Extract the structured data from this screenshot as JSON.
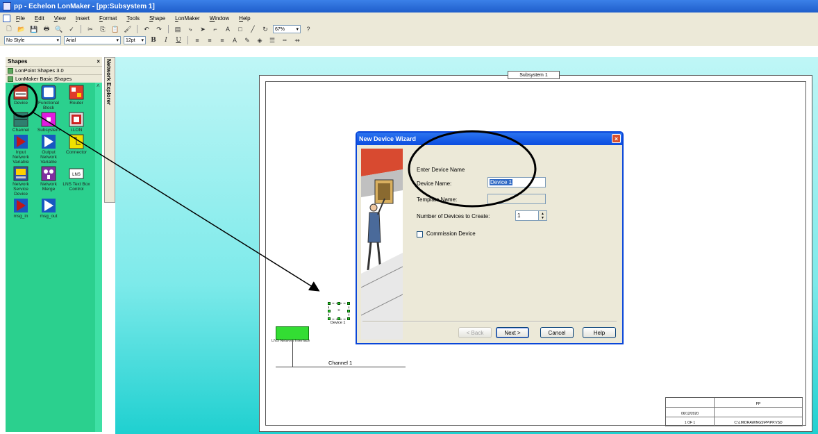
{
  "window": {
    "title": "pp - Echelon LonMaker - [pp:Subsystem 1]"
  },
  "menu": {
    "items": [
      "File",
      "Edit",
      "View",
      "Insert",
      "Format",
      "Tools",
      "Shape",
      "LonMaker",
      "Window",
      "Help"
    ]
  },
  "toolbar": {
    "zoom": "67%",
    "style": "No Style",
    "font": "Arial",
    "font_size": "12pt"
  },
  "shapes_panel": {
    "title": "Shapes",
    "close": "×",
    "stencils": [
      "LonPoint Shapes 3.0",
      "LonMaker Basic Shapes"
    ],
    "items": [
      {
        "label": "Device",
        "color": "#c0392b"
      },
      {
        "label": "Functional Block",
        "color": "#3aa0e0"
      },
      {
        "label": "Router",
        "color": "#e03a2a"
      },
      {
        "label": "Channel",
        "color": "#2f7f6f"
      },
      {
        "label": "Subsystem",
        "color": "#e01be0"
      },
      {
        "label": "i.LON",
        "color": "#cc2222"
      },
      {
        "label": "Input Network Variable",
        "color": "#c01818"
      },
      {
        "label": "Output Network Variable",
        "color": "#1858c0"
      },
      {
        "label": "Connector",
        "color": "#f0e000"
      },
      {
        "label": "Network Service Device",
        "color": "#3050a0"
      },
      {
        "label": "Network Merge",
        "color": "#8030a0"
      },
      {
        "label": "LNS Text Box Control",
        "color": "#ffffff"
      },
      {
        "label": "msg_in",
        "color": "#c01818"
      },
      {
        "label": "msg_out",
        "color": "#1858c0"
      }
    ]
  },
  "network_explorer": {
    "label": "Network Explorer"
  },
  "drawing": {
    "subsystem_title": "Subsystem 1",
    "device_label": "Device 1",
    "lns_label": "LNS Network Interface",
    "channel_label": "Channel 1",
    "title_block": {
      "name": "PP",
      "date": "06/12/2020",
      "page": "1 OF 1",
      "path": "C:\\LM\\DRAWINGS\\PP\\PP.VSD"
    }
  },
  "dialog": {
    "title": "New Device Wizard",
    "close": "×",
    "heading": "Enter Device Name",
    "device_name_label": "Device Name:",
    "device_name_value": "Device 1",
    "template_name_label": "Template Name:",
    "template_name_value": "",
    "count_label": "Number of Devices to Create:",
    "count_value": "1",
    "commission_label": "Commission Device",
    "buttons": {
      "back": "< Back",
      "next": "Next >",
      "cancel": "Cancel",
      "help": "Help"
    }
  }
}
